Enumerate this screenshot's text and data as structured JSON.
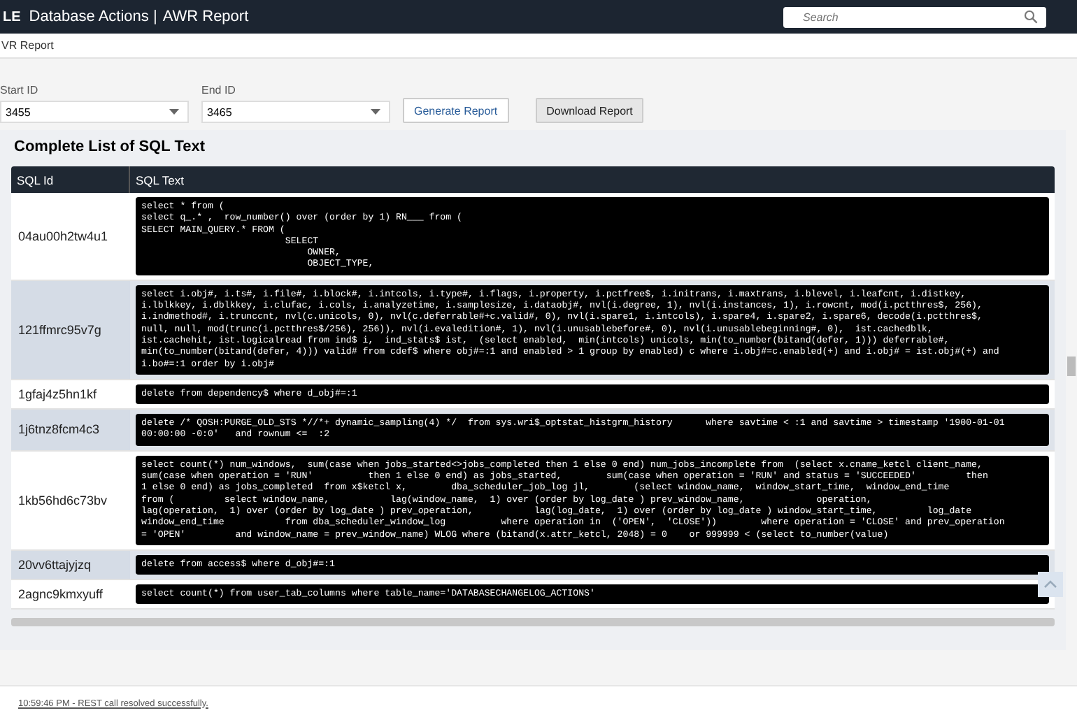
{
  "header": {
    "logo_text": "LE",
    "app_title": "Database Actions |",
    "page_title": "AWR Report",
    "search": {
      "placeholder": "Search"
    }
  },
  "breadcrumb": "VR Report",
  "form": {
    "start": {
      "label": "Start ID",
      "value": "3455"
    },
    "end": {
      "label": "End ID",
      "value": "3465"
    },
    "buttons": [
      {
        "label": "Generate Report",
        "kind": "outline"
      },
      {
        "label": "Download Report",
        "kind": "filled"
      }
    ]
  },
  "panel": {
    "title": "Complete List of SQL Text",
    "table": {
      "columns": [
        "SQL Id",
        "SQL Text"
      ],
      "rows": [
        {
          "sql_id": "04au00h2tw4u1",
          "highlighted": false,
          "sql_text": [
            "select * from (",
            "select q_.* ,  row_number() over (order by 1) RN___ from (",
            "SELECT MAIN_QUERY.* FROM (",
            "                          SELECT",
            "                              OWNER,",
            "                              OBJECT_TYPE,"
          ]
        },
        {
          "sql_id": "121ffmrc95v7g",
          "highlighted": true,
          "sql_text": [
            "select i.obj#, i.ts#, i.file#, i.block#, i.intcols, i.type#, i.flags, i.property, i.pctfree$, i.initrans, i.maxtrans, i.blevel, i.leafcnt, i.distkey,",
            "i.lblkkey, i.dblkkey, i.clufac, i.cols, i.analyzetime, i.samplesize, i.dataobj#, nvl(i.degree, 1), nvl(i.instances, 1), i.rowcnt, mod(i.pctthres$, 256),",
            "i.indmethod#, i.trunccnt, nvl(c.unicols, 0), nvl(c.deferrable#+c.valid#, 0), nvl(i.spare1, i.intcols), i.spare4, i.spare2, i.spare6, decode(i.pctthres$,",
            "null, null, mod(trunc(i.pctthres$/256), 256)), nvl(i.evaledition#, 1), nvl(i.unusablebefore#, 0), nvl(i.unusablebeginning#, 0),  ist.cachedblk,",
            "ist.cachehit, ist.logicalread from ind$ i,  ind_stats$ ist,  (select enabled,  min(intcols) unicols, min(to_number(bitand(defer, 1))) deferrable#,",
            "min(to_number(bitand(defer, 4))) valid# from cdef$ where obj#=:1 and enabled > 1 group by enabled) c where i.obj#=c.enabled(+) and i.obj# = ist.obj#(+) and",
            "i.bo#=:1 order by i.obj#"
          ]
        },
        {
          "sql_id": "1gfaj4z5hn1kf",
          "highlighted": false,
          "sql_text": [
            "delete from dependency$ where d_obj#=:1"
          ]
        },
        {
          "sql_id": "1j6tnz8fcm4c3",
          "highlighted": true,
          "sql_text": [
            "delete /* QOSH:PURGE_OLD_STS *//*+ dynamic_sampling(4) */  from sys.wri$_optstat_histgrm_history      where savtime < :1 and savtime > timestamp '1900-01-01",
            "00:00:00 -0:0'   and rownum <=  :2"
          ]
        },
        {
          "sql_id": "1kb56hd6c73bv",
          "highlighted": false,
          "sql_text": [
            "select count(*) num_windows,  sum(case when jobs_started<>jobs_completed then 1 else 0 end) num_jobs_incomplete from  (select x.cname_ketcl client_name,",
            "sum(case when operation = 'RUN'          then 1 else 0 end) as jobs_started,        sum(case when operation = 'RUN' and status = 'SUCCEEDED'         then",
            "1 else 0 end) as jobs_completed  from x$ketcl x,        dba_scheduler_job_log jl,        (select window_name,  window_start_time,  window_end_time",
            "from (         select window_name,           lag(window_name,  1) over (order by log_date ) prev_window_name,             operation,",
            "lag(operation,  1) over (order by log_date ) prev_operation,           lag(log_date,  1) over (order by log_date ) window_start_time,         log_date",
            "window_end_time           from dba_scheduler_window_log          where operation in  ('OPEN',  'CLOSE'))        where operation = 'CLOSE' and prev_operation",
            "= 'OPEN'         and window_name = prev_window_name) WLOG where (bitand(x.attr_ketcl, 2048) = 0    or 999999 < (select to_number(value)"
          ]
        },
        {
          "sql_id": "20vv6ttajyjzq",
          "highlighted": true,
          "sql_text": [
            "delete from access$ where d_obj#=:1"
          ]
        },
        {
          "sql_id": "2agnc9kmxyuff",
          "highlighted": false,
          "sql_text": [
            "select count(*) from user_tab_columns where table_name='DATABASECHANGELOG_ACTIONS'"
          ]
        }
      ]
    }
  },
  "status_bar": {
    "message": "10:59:46 PM - REST call resolved successfully."
  }
}
